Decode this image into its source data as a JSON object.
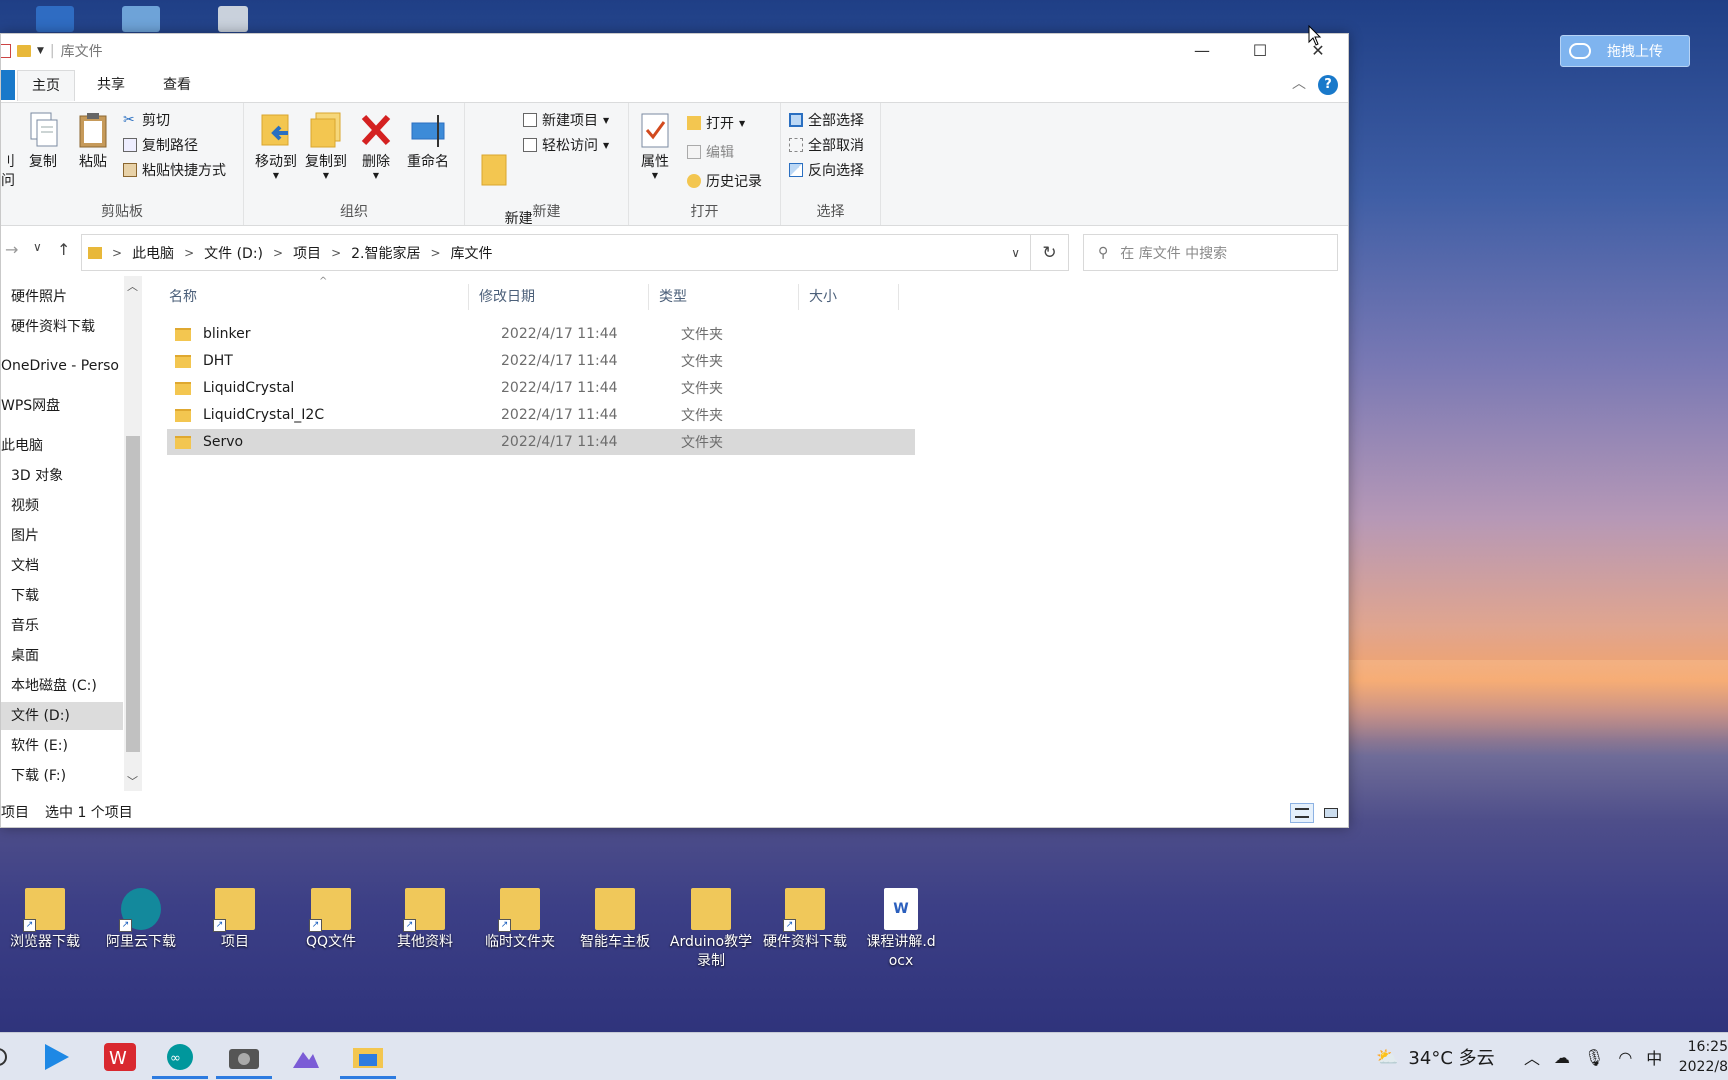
{
  "window": {
    "title": "库文件",
    "tabs": [
      "主页",
      "共享",
      "查看"
    ],
    "help_label": "?"
  },
  "ribbon": {
    "clipboard": {
      "label": "剪贴板",
      "pin_partial": "刂\n问",
      "copy": "复制",
      "paste": "粘贴",
      "cut": "剪切",
      "copy_path": "复制路径",
      "paste_shortcut": "粘贴快捷方式"
    },
    "organize": {
      "label": "组织",
      "move_to": "移动到",
      "copy_to": "复制到",
      "delete": "删除",
      "rename": "重命名"
    },
    "new": {
      "label": "新建",
      "new_folder": "新建\n文件夹",
      "new_item": "新建项目",
      "easy_access": "轻松访问"
    },
    "open": {
      "label": "打开",
      "properties": "属性",
      "open": "打开",
      "edit": "编辑",
      "history": "历史记录"
    },
    "select": {
      "label": "选择",
      "select_all": "全部选择",
      "select_none": "全部取消",
      "invert": "反向选择"
    }
  },
  "address": {
    "crumbs": [
      "此电脑",
      "文件 (D:)",
      "项目",
      "2.智能家居",
      "库文件"
    ],
    "search_placeholder": "在 库文件 中搜索"
  },
  "nav": {
    "items": [
      {
        "label": "硬件照片",
        "selected": false
      },
      {
        "label": "硬件资料下载",
        "selected": false
      },
      {
        "label": "OneDrive - Perso",
        "selected": false
      },
      {
        "label": "WPS网盘",
        "selected": false
      },
      {
        "label": "此电脑",
        "selected": false
      },
      {
        "label": "3D 对象",
        "selected": false
      },
      {
        "label": "视频",
        "selected": false
      },
      {
        "label": "图片",
        "selected": false
      },
      {
        "label": "文档",
        "selected": false
      },
      {
        "label": "下载",
        "selected": false
      },
      {
        "label": "音乐",
        "selected": false
      },
      {
        "label": "桌面",
        "selected": false
      },
      {
        "label": "本地磁盘 (C:)",
        "selected": false
      },
      {
        "label": "文件 (D:)",
        "selected": true
      },
      {
        "label": "软件 (E:)",
        "selected": false
      },
      {
        "label": "下载 (F:)",
        "selected": false
      }
    ]
  },
  "columns": {
    "name": "名称",
    "date": "修改日期",
    "type": "类型",
    "size": "大小"
  },
  "files": [
    {
      "name": "blinker",
      "date": "2022/4/17 11:44",
      "type": "文件夹",
      "selected": false
    },
    {
      "name": "DHT",
      "date": "2022/4/17 11:44",
      "type": "文件夹",
      "selected": false
    },
    {
      "name": "LiquidCrystal",
      "date": "2022/4/17 11:44",
      "type": "文件夹",
      "selected": false
    },
    {
      "name": "LiquidCrystal_I2C",
      "date": "2022/4/17 11:44",
      "type": "文件夹",
      "selected": false
    },
    {
      "name": "Servo",
      "date": "2022/4/17 11:44",
      "type": "文件夹",
      "selected": true
    }
  ],
  "status": {
    "count": "项目",
    "selection": "选中 1 个项目"
  },
  "upload_button": "拖拽上传",
  "desktop_icons": [
    {
      "label": "浏览器下载",
      "color": "#f0c85a"
    },
    {
      "label": "阿里云下载",
      "color": "#13899c"
    },
    {
      "label": "项目",
      "color": "#f0c85a"
    },
    {
      "label": "QQ文件",
      "color": "#f0c85a"
    },
    {
      "label": "其他资料",
      "color": "#f0c85a"
    },
    {
      "label": "临时文件夹",
      "color": "#f0c85a"
    },
    {
      "label": "智能车主板",
      "color": "#f0c85a"
    },
    {
      "label": "Arduino教学录制",
      "color": "#f0c85a"
    },
    {
      "label": "硬件资料下载",
      "color": "#f0c85a"
    },
    {
      "label": "课程讲解.docx",
      "color": "#ffffff"
    }
  ],
  "taskbar": {
    "weather": "34°C 多云",
    "ime": "中",
    "time": "16:25",
    "date": "2022/8"
  }
}
